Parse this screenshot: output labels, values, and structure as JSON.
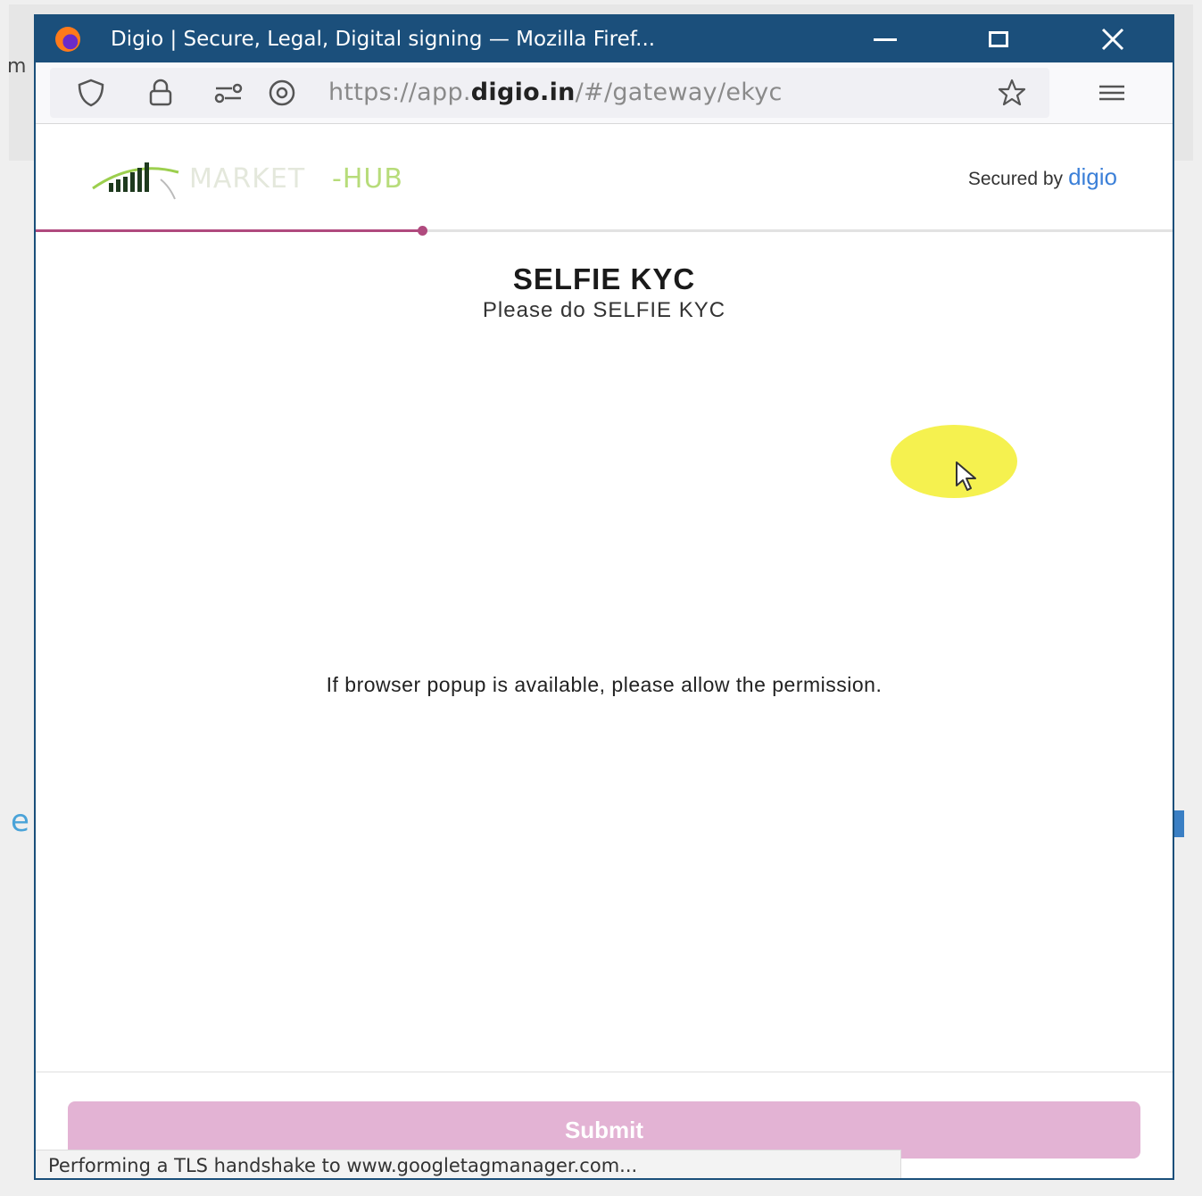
{
  "window": {
    "title": "Digio | Secure, Legal, Digital signing — Mozilla Firef...",
    "minimize_label": "minimize",
    "maximize_label": "maximize",
    "close_label": "close"
  },
  "browser": {
    "url_prefix": "https://app.",
    "url_domain": "digio.in",
    "url_path": "/#/gateway/ekyc",
    "status_text": "Performing a TLS handshake to www.googletagmanager.com..."
  },
  "header": {
    "logo_suffix": "-HUB",
    "secured_label": "Secured by",
    "secured_brand": "digio"
  },
  "progress": {
    "fraction": 0.34
  },
  "main": {
    "title": "SELFIE KYC",
    "subtitle": "Please do SELFIE KYC",
    "message": "If browser popup is available, please allow the permission."
  },
  "footer": {
    "submit_label": "Submit"
  },
  "colors": {
    "titlebar": "#1b4f7b",
    "accent": "#b04a7e",
    "submit_disabled": "#e3b3d4",
    "brand_blue": "#3c80d8",
    "logo_green": "#b7dc7a",
    "cursor_highlight": "#f4ef3c"
  },
  "icons": {
    "tracking": "shield-icon",
    "lock": "lock-icon",
    "permissions": "permissions-icon",
    "reader": "reader-view-icon",
    "bookmark": "star-icon",
    "menu": "hamburger-menu-icon",
    "cursor": "mouse-cursor-icon"
  }
}
